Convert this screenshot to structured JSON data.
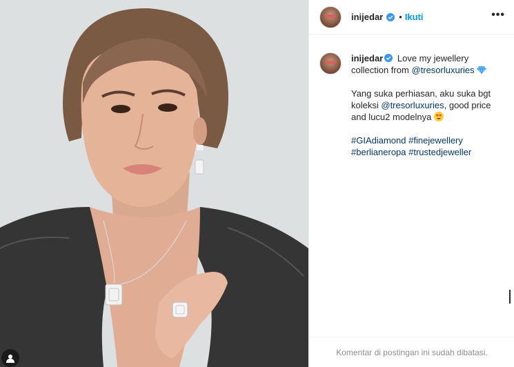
{
  "post": {
    "username": "inijedar",
    "follow_label": "Ikuti",
    "separator": "•",
    "more_label": "•••"
  },
  "caption": {
    "username": "inijedar",
    "line1_text": "Love my jewellery collection from",
    "line1_mention": "@tresorluxuries",
    "p2_pre": "Yang suka perhiasan, aku suka bgt koleksi",
    "p2_mention": "@tresorluxuries",
    "p2_post": ", good price and lucu2 modelnya",
    "hashtags": [
      "#GIAdiamond",
      "#finejewellery",
      "#berlianeropa",
      "#trustedjeweller"
    ]
  },
  "footer": {
    "comments_disabled": "Komentar di postingan ini sudah dibatasi."
  },
  "colors": {
    "link_blue": "#0095f6",
    "mention_blue": "#00376b",
    "verified_blue": "#3897f0",
    "muted_text": "#8e8e8e"
  },
  "icons": {
    "verified": "verified-badge-icon",
    "diamond": "gem-emoji-icon",
    "heart_eyes": "heart-eyes-emoji-icon",
    "more": "more-options-icon"
  }
}
